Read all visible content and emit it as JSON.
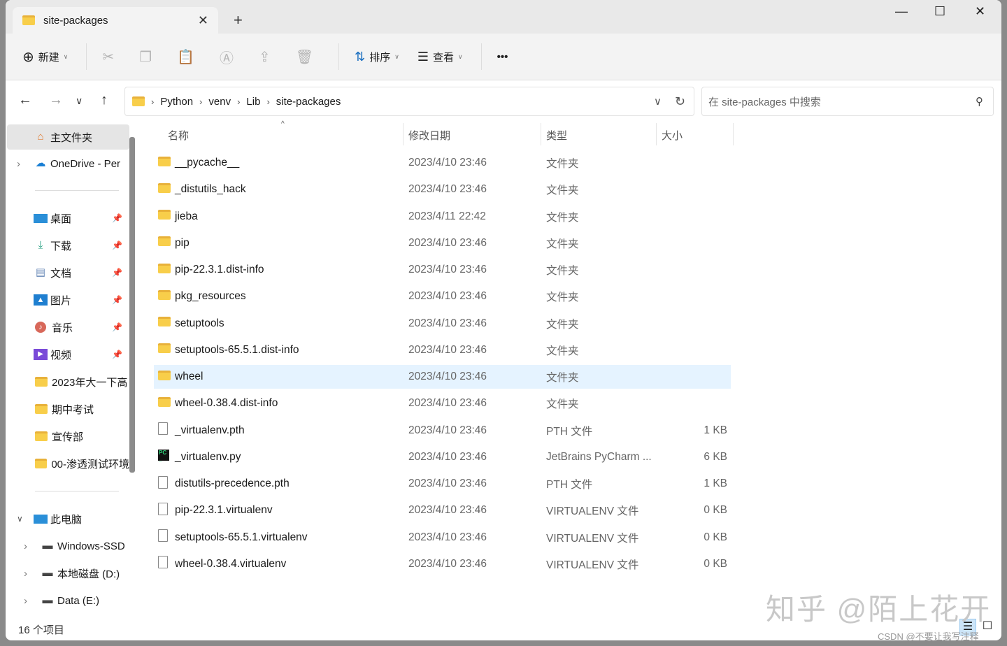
{
  "tab": {
    "title": "site-packages",
    "close": "✕",
    "new": "+"
  },
  "window": {
    "minimize": "—",
    "maximize": "☐",
    "close": "✕"
  },
  "toolbar": {
    "new_label": "新建",
    "sort_label": "排序",
    "view_label": "查看",
    "more": "•••"
  },
  "address": {
    "crumbs": [
      "Python",
      "venv",
      "Lib",
      "site-packages"
    ],
    "search_placeholder": "在 site-packages 中搜索"
  },
  "sidebar": {
    "home": "主文件夹",
    "onedrive": "OneDrive - Per",
    "quick": [
      {
        "label": "桌面",
        "icon": "desktop-icon"
      },
      {
        "label": "下载",
        "icon": "download-icon"
      },
      {
        "label": "文档",
        "icon": "documents-icon"
      },
      {
        "label": "图片",
        "icon": "pictures-icon"
      },
      {
        "label": "音乐",
        "icon": "music-icon"
      },
      {
        "label": "视频",
        "icon": "videos-icon"
      }
    ],
    "folders": [
      "2023年大一下高",
      "期中考试",
      "宣传部",
      "00-渗透测试环境"
    ],
    "pc": "此电脑",
    "drives": [
      "Windows-SSD",
      "本地磁盘 (D:)",
      "Data (E:)"
    ]
  },
  "columns": {
    "name": "名称",
    "date": "修改日期",
    "type": "类型",
    "size": "大小"
  },
  "files": [
    {
      "name": "__pycache__",
      "date": "2023/4/10 23:46",
      "type": "文件夹",
      "size": "",
      "kind": "folder"
    },
    {
      "name": "_distutils_hack",
      "date": "2023/4/10 23:46",
      "type": "文件夹",
      "size": "",
      "kind": "folder"
    },
    {
      "name": "jieba",
      "date": "2023/4/11 22:42",
      "type": "文件夹",
      "size": "",
      "kind": "folder"
    },
    {
      "name": "pip",
      "date": "2023/4/10 23:46",
      "type": "文件夹",
      "size": "",
      "kind": "folder"
    },
    {
      "name": "pip-22.3.1.dist-info",
      "date": "2023/4/10 23:46",
      "type": "文件夹",
      "size": "",
      "kind": "folder"
    },
    {
      "name": "pkg_resources",
      "date": "2023/4/10 23:46",
      "type": "文件夹",
      "size": "",
      "kind": "folder"
    },
    {
      "name": "setuptools",
      "date": "2023/4/10 23:46",
      "type": "文件夹",
      "size": "",
      "kind": "folder"
    },
    {
      "name": "setuptools-65.5.1.dist-info",
      "date": "2023/4/10 23:46",
      "type": "文件夹",
      "size": "",
      "kind": "folder"
    },
    {
      "name": "wheel",
      "date": "2023/4/10 23:46",
      "type": "文件夹",
      "size": "",
      "kind": "folder",
      "selected": true
    },
    {
      "name": "wheel-0.38.4.dist-info",
      "date": "2023/4/10 23:46",
      "type": "文件夹",
      "size": "",
      "kind": "folder"
    },
    {
      "name": "_virtualenv.pth",
      "date": "2023/4/10 23:46",
      "type": "PTH 文件",
      "size": "1 KB",
      "kind": "file"
    },
    {
      "name": "_virtualenv.py",
      "date": "2023/4/10 23:46",
      "type": "JetBrains PyCharm ...",
      "size": "6 KB",
      "kind": "pycharm"
    },
    {
      "name": "distutils-precedence.pth",
      "date": "2023/4/10 23:46",
      "type": "PTH 文件",
      "size": "1 KB",
      "kind": "file"
    },
    {
      "name": "pip-22.3.1.virtualenv",
      "date": "2023/4/10 23:46",
      "type": "VIRTUALENV 文件",
      "size": "0 KB",
      "kind": "file"
    },
    {
      "name": "setuptools-65.5.1.virtualenv",
      "date": "2023/4/10 23:46",
      "type": "VIRTUALENV 文件",
      "size": "0 KB",
      "kind": "file"
    },
    {
      "name": "wheel-0.38.4.virtualenv",
      "date": "2023/4/10 23:46",
      "type": "VIRTUALENV 文件",
      "size": "0 KB",
      "kind": "file"
    }
  ],
  "status": "16 个项目",
  "watermark": "知乎 @陌上花开",
  "watermark2": "CSDN @不要让我写注释"
}
